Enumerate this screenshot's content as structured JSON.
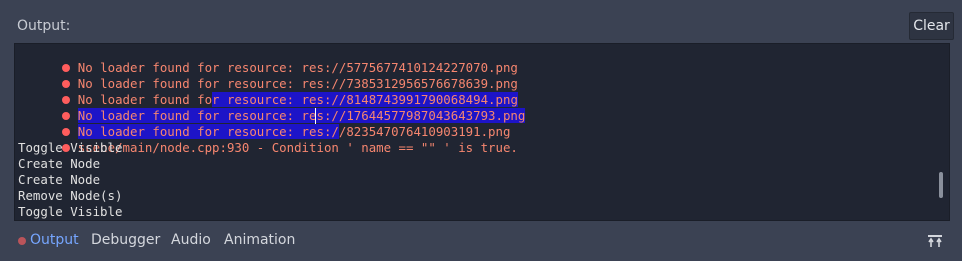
{
  "header": {
    "title": "Output:",
    "clear_label": "Clear"
  },
  "log": {
    "lines": [
      {
        "type": "error",
        "text": "No loader found for resource: res://5775677410124227070.png"
      },
      {
        "type": "error",
        "text": "No loader found for resource: res://7385312956576678639.png"
      },
      {
        "type": "error",
        "text_a": "No loader found fo",
        "text_b": "r resource: res://8148743991790068494.png"
      },
      {
        "type": "error",
        "text": "No loader found for resource: res://17644577987043643793.png"
      },
      {
        "type": "error",
        "text_a": "No loader found for resource: res:/",
        "text_b": "/823547076410903191.png"
      },
      {
        "type": "error",
        "text": "scene/main/node.cpp:930 - Condition ' name == \"\" ' is true."
      },
      {
        "type": "info",
        "text": "Toggle Visible"
      },
      {
        "type": "info",
        "text": "Create Node"
      },
      {
        "type": "info",
        "text": "Create Node"
      },
      {
        "type": "info",
        "text": "Remove Node(s)"
      },
      {
        "type": "info",
        "text": "Toggle Visible"
      }
    ]
  },
  "tabs": [
    {
      "label": "Output",
      "active": true
    },
    {
      "label": "Debugger"
    },
    {
      "label": "Audio"
    },
    {
      "label": "Animation"
    }
  ],
  "colors": {
    "error": "#f6866f",
    "selection": "#1d14c8",
    "active_tab": "#76a6ff"
  }
}
